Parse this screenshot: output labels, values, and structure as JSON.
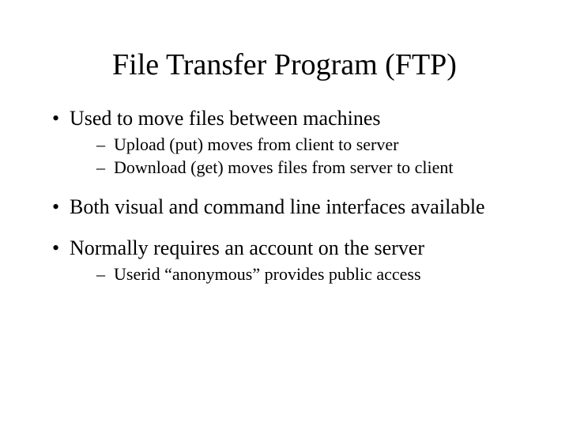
{
  "title": "File Transfer Program (FTP)",
  "bullets": [
    {
      "text": "Used to move files between machines",
      "sub": [
        "Upload (put) moves from client to server",
        "Download (get) moves files from server to client"
      ]
    },
    {
      "text": "Both visual and command line interfaces available",
      "sub": []
    },
    {
      "text": "Normally requires an account on the server",
      "sub": [
        "Userid “anonymous” provides public access"
      ]
    }
  ]
}
